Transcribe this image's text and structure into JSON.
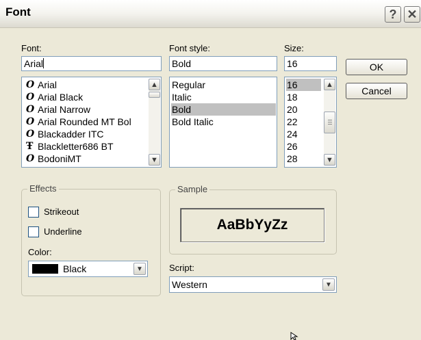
{
  "window": {
    "title": "Font",
    "help_label": "?",
    "close_label": "✕"
  },
  "font": {
    "label": "Font:",
    "value": "Arial",
    "items": [
      {
        "icon": "O",
        "name": "Arial"
      },
      {
        "icon": "O",
        "name": "Arial Black"
      },
      {
        "icon": "O",
        "name": "Arial Narrow"
      },
      {
        "icon": "O",
        "name": "Arial Rounded MT Bol"
      },
      {
        "icon": "O",
        "name": "Blackadder ITC"
      },
      {
        "icon": "Ŧ",
        "name": "Blackletter686 BT"
      },
      {
        "icon": "O",
        "name": "BodoniMT"
      }
    ]
  },
  "style": {
    "label": "Font style:",
    "value": "Bold",
    "items": [
      "Regular",
      "Italic",
      "Bold",
      "Bold Italic"
    ],
    "selected": "Bold"
  },
  "size": {
    "label": "Size:",
    "value": "16",
    "items": [
      "16",
      "18",
      "20",
      "22",
      "24",
      "26",
      "28"
    ],
    "selected": "16"
  },
  "buttons": {
    "ok": "OK",
    "cancel": "Cancel"
  },
  "effects": {
    "label": "Effects",
    "strikeout": "Strikeout",
    "underline": "Underline",
    "color_label": "Color:",
    "color_value": "Black",
    "color_swatch": "#000000"
  },
  "sample": {
    "label": "Sample",
    "text": "AaBbYyZz"
  },
  "script": {
    "label": "Script:",
    "value": "Western"
  },
  "icons": {
    "scroll_up": "up-arrow",
    "scroll_down": "down-arrow",
    "dropdown": "chevron-down"
  }
}
